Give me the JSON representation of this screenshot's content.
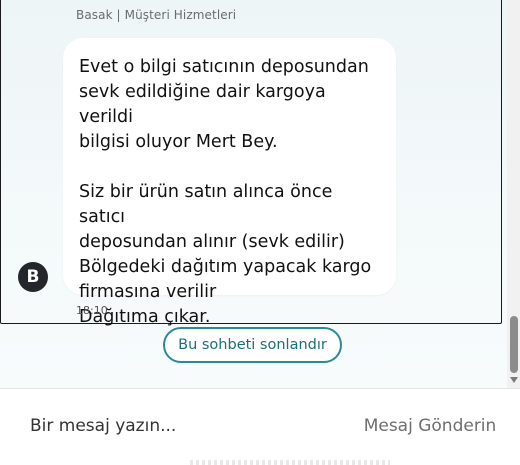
{
  "conversation": {
    "sender_name": "Basak | Müşteri Hizmetleri",
    "avatar_letter": "B",
    "message_text": "Evet o bilgi satıcının deposundan\nsevk edildiğine dair kargoya verildi\nbilgisi oluyor Mert Bey.\n\nSiz bir ürün satın alınca önce satıcı\ndeposundan alınır (sevk edilir)\nBölgedeki dağıtım yapacak kargo\nfirmasına verilir\nDağıtıma çıkar.",
    "timestamp": "18:10"
  },
  "actions": {
    "end_chat_label": "Bu sohbeti sonlandır"
  },
  "composer": {
    "placeholder": "Bir mesaj yazın...",
    "value": "",
    "send_label": "Mesaj Gönderin"
  },
  "colors": {
    "accent": "#2a8a95",
    "avatar_bg": "#23272b",
    "chat_bg": "#eef5f7"
  },
  "icons": {
    "scroll_down": "chevron-down-icon"
  }
}
